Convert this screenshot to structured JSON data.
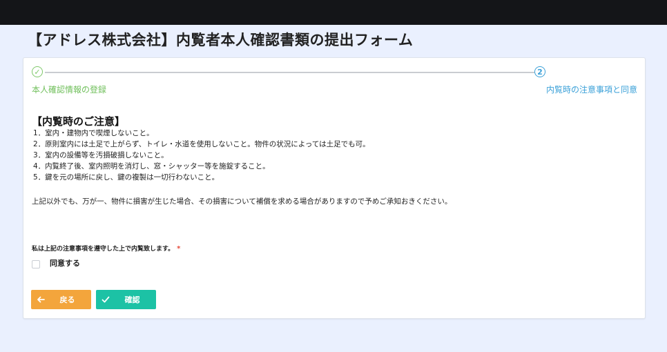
{
  "header": {
    "title": "【アドレス株式会社】内覧者本人確認書類の提出フォーム"
  },
  "stepper": {
    "steps": [
      {
        "number": "✓",
        "label": "本人確認情報の登録",
        "color": "#7ec86a"
      },
      {
        "number": "2",
        "label": "内覧時の注意事項と同意",
        "color": "#3aa0d8"
      }
    ]
  },
  "notice": {
    "title": "【内覧時のご注意】",
    "items": [
      "1．室内・建物内で喫煙しないこと。",
      "2．原則室内には土足で上がらず、トイレ・水道を使用しないこと。物件の状況によっては土足でも可。",
      "3．室内の設備等を汚損破損しないこと。",
      "4．内覧終了後、室内照明を消灯し、窓・シャッター等を施錠すること。",
      "5．鍵を元の場所に戻し、鍵の複製は一切行わないこと。"
    ],
    "extra": "上記以外でも、万が一、物件に損害が生じた場合、その損害について補償を求める場合がありますので予めご承知おきください。"
  },
  "consent": {
    "label": "私は上記の注意事項を遵守した上で内覧致します。",
    "required_mark": "*",
    "checkbox_label": "同意する"
  },
  "buttons": {
    "back_label": "戻る",
    "confirm_label": "確認",
    "back_color": "#f3a53c",
    "confirm_color": "#1cc2a5"
  },
  "icons": {
    "back": "arrow-left-icon",
    "confirm": "check-icon"
  }
}
